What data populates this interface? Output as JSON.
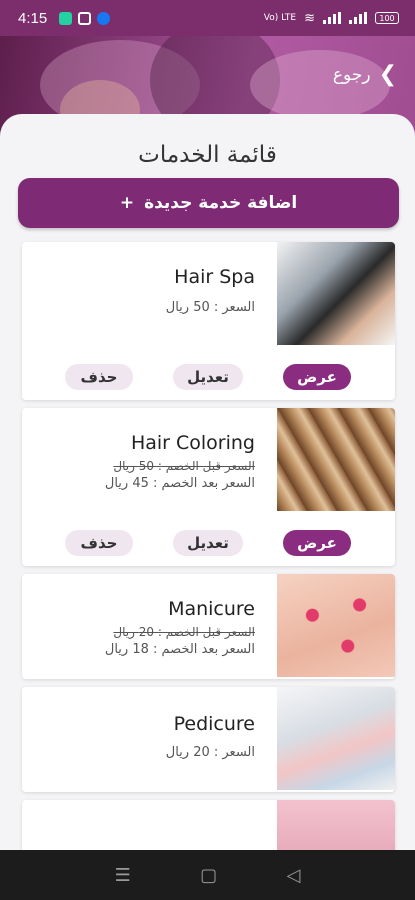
{
  "status_bar": {
    "time": "4:15",
    "network_label": "Vo) LTE",
    "battery_label": "100"
  },
  "header": {
    "back_label": "رجوع"
  },
  "page": {
    "title": "قائمة الخدمات",
    "add_button_label": "اضافة خدمة جديدة",
    "add_button_icon": "+"
  },
  "actions": {
    "view": "عرض",
    "edit": "تعديل",
    "delete": "حذف"
  },
  "services": [
    {
      "name": "Hair Spa",
      "price": "السعر : 50 ريال",
      "thumb": "hair-spa-image"
    },
    {
      "name": "Hair Coloring",
      "old_price": "السعر قبل الخصم : 50 ريال",
      "new_price": "السعر بعد الخصم : 45 ريال",
      "thumb": "hair-coloring-image"
    },
    {
      "name": "Manicure",
      "old_price": "السعر قبل الخصم : 20 ريال",
      "new_price": "السعر بعد الخصم : 18 ريال",
      "thumb": "manicure-image"
    },
    {
      "name": "Pedicure",
      "price": "السعر : 20 ريال",
      "thumb": "pedicure-image"
    }
  ],
  "nav": {
    "menu_icon": "menu-icon",
    "home_icon": "home-icon",
    "back_icon": "back-triangle-icon"
  },
  "colors": {
    "accent": "#7e2a74",
    "pill_light": "#f0e6ef"
  }
}
